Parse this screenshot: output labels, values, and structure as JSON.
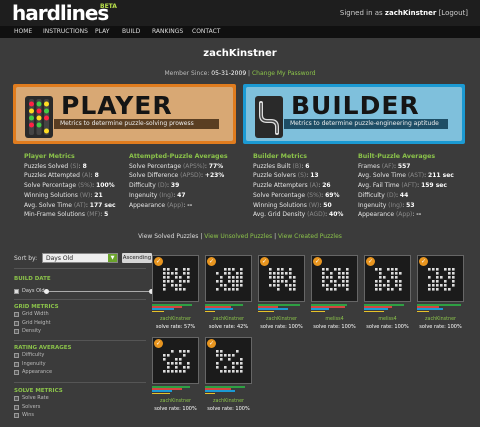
{
  "header": {
    "logo": "hardlines",
    "beta": "BETA",
    "signed_prefix": "Signed in as ",
    "signed_user": "zachKinstner",
    "logout": "[Logout]"
  },
  "nav": [
    "HOME",
    "INSTRUCTIONS",
    "PLAY",
    "BUILD",
    "RANKINGS",
    "CONTACT"
  ],
  "profile": {
    "username": "zachKinstner",
    "member_label": "Member Since: ",
    "member_date": "05-31-2009",
    "sep": " | ",
    "change_password": "Change My Password"
  },
  "banners": {
    "player": {
      "title": "PLAYER",
      "subtitle": "Metrics to determine puzzle-solving prowess",
      "accent": "#e07c1e"
    },
    "builder": {
      "title": "BUILDER",
      "subtitle": "Metrics to determine puzzle-engineering aptitude",
      "accent": "#1b9ad3"
    }
  },
  "stats": {
    "player_metrics": {
      "heading": "Player Metrics",
      "rows": [
        {
          "label": "Puzzles Solved ",
          "abbr": "(S)",
          "value": "8"
        },
        {
          "label": "Puzzles Attempted ",
          "abbr": "(A)",
          "value": "8"
        },
        {
          "label": "Solve Percentage ",
          "abbr": "(S%)",
          "value": "100%"
        },
        {
          "label": "Winning Solutions ",
          "abbr": "(W)",
          "value": "21"
        },
        {
          "label": "Avg. Solve Time ",
          "abbr": "(AT)",
          "value": "177 sec"
        },
        {
          "label": "Min-Frame Solutions ",
          "abbr": "(MF)",
          "value": "5"
        }
      ]
    },
    "attempted_averages": {
      "heading": "Attempted-Puzzle Averages",
      "rows": [
        {
          "label": "Solve Percentage ",
          "abbr": "(APS%)",
          "value": "77%"
        },
        {
          "label": "Solve Difference ",
          "abbr": "(APSD)",
          "value": "+23%"
        },
        {
          "label": "Difficulty ",
          "abbr": "(D)",
          "value": "39"
        },
        {
          "label": "Ingenuity ",
          "abbr": "(Ing)",
          "value": "47"
        },
        {
          "label": "Appearance ",
          "abbr": "(App)",
          "value": "--"
        }
      ]
    },
    "builder_metrics": {
      "heading": "Builder Metrics",
      "rows": [
        {
          "label": "Puzzles Built ",
          "abbr": "(B)",
          "value": "6"
        },
        {
          "label": "Puzzle Solvers ",
          "abbr": "(S)",
          "value": "13"
        },
        {
          "label": "Puzzle Attempters ",
          "abbr": "(A)",
          "value": "26"
        },
        {
          "label": "Solve Percentage ",
          "abbr": "(S%)",
          "value": "69%"
        },
        {
          "label": "Winning Solutions ",
          "abbr": "(W)",
          "value": "50"
        },
        {
          "label": "Avg. Grid Density ",
          "abbr": "(AGD)",
          "value": "40%"
        }
      ]
    },
    "built_averages": {
      "heading": "Built-Puzzle Averages",
      "rows": [
        {
          "label": "Frames ",
          "abbr": "(AF)",
          "value": "557"
        },
        {
          "label": "Avg. Solve Time ",
          "abbr": "(AST)",
          "value": "211 sec"
        },
        {
          "label": "Avg. Fail Time ",
          "abbr": "(AFT)",
          "value": "159 sec"
        },
        {
          "label": "Difficulty ",
          "abbr": "(D)",
          "value": "44"
        },
        {
          "label": "Ingenuity ",
          "abbr": "(Ing)",
          "value": "53"
        },
        {
          "label": "Appearance ",
          "abbr": "(App)",
          "value": "--"
        }
      ]
    }
  },
  "views": {
    "solved": "View Solved Puzzles",
    "unsolved": "View Unsolved Puzzles",
    "created": "View Created Puzzles",
    "sep": " | "
  },
  "sidebar": {
    "sort_label": "Sort by:",
    "sort_value": "Days Old",
    "ascending": "Ascending",
    "build_date": {
      "heading": "BUILD DATE",
      "item": "Days Old"
    },
    "grid_metrics": {
      "heading": "GRID METRICS",
      "items": [
        "Grid Width",
        "Grid Height",
        "Density"
      ]
    },
    "rating_averages": {
      "heading": "RATING AVERAGES",
      "items": [
        "Difficulty",
        "Ingenuity",
        "Appearance"
      ]
    },
    "solve_metrics": {
      "heading": "SOLVE METRICS",
      "items": [
        "Solve Rate",
        "Solvers",
        "Wins"
      ]
    }
  },
  "puzzles": [
    {
      "builder": "zachKinstner",
      "rate": "solve rate: 57%"
    },
    {
      "builder": "zachKinstner",
      "rate": "solve rate: 42%"
    },
    {
      "builder": "zachKinstner",
      "rate": "solve rate: 100%"
    },
    {
      "builder": "meliss4",
      "rate": "solve rate: 100%"
    },
    {
      "builder": "meliss4",
      "rate": "solve rate: 100%"
    },
    {
      "builder": "zachKinstner",
      "rate": "solve rate: 100%"
    },
    {
      "builder": "zachKinstner",
      "rate": "solve rate: 100%"
    },
    {
      "builder": "zachKinstner",
      "rate": "solve rate: 100%"
    }
  ],
  "colors": {
    "accent_green": "#8bc34a",
    "player_orange": "#e07c1e",
    "builder_blue": "#1b9ad3",
    "check_orange": "#e8951f"
  }
}
